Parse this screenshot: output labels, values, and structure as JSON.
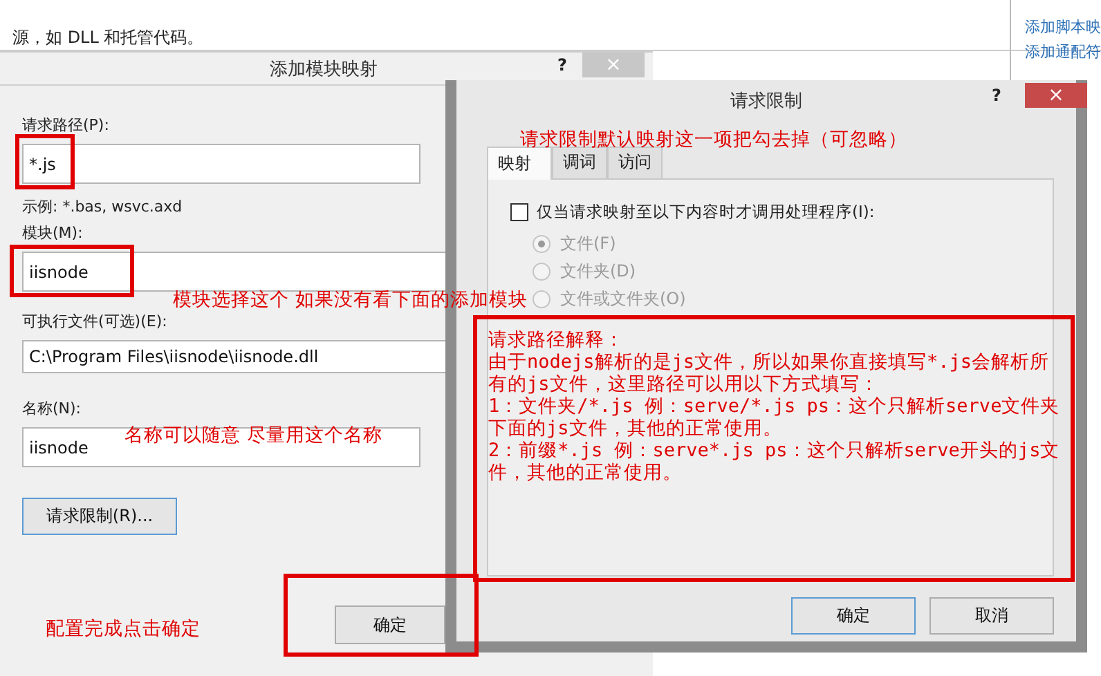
{
  "background": {
    "description": "源，如 DLL 和托管代码。",
    "links": [
      "添加脚本映",
      "添加通配符"
    ]
  },
  "module_dialog": {
    "title": "添加模块映射",
    "help": "?",
    "close": "×",
    "fields": [
      {
        "label": "请求路径(P):",
        "value": "*.js",
        "hint": "示例: *.bas, wsvc.axd"
      },
      {
        "label": "模块(M):",
        "value": "iisnode"
      },
      {
        "label": "可执行文件(可选)(E):",
        "value": "C:\\Program Files\\iisnode\\iisnode.dll"
      },
      {
        "label": "名称(N):",
        "value": "iisnode"
      }
    ],
    "restrict_button": "请求限制(R)...",
    "ok_button": "确定"
  },
  "restriction_dialog": {
    "title": "请求限制",
    "help": "?",
    "close": "×",
    "tabs": [
      {
        "label": "映射",
        "selected": true
      },
      {
        "label": "调词",
        "selected": false
      },
      {
        "label": "访问",
        "selected": false
      }
    ],
    "checkbox": {
      "label": "仅当请求映射至以下内容时才调用处理程序(I):",
      "checked": false
    },
    "radios": [
      {
        "label": "文件(F)",
        "selected": true,
        "disabled": true
      },
      {
        "label": "文件夹(D)",
        "selected": false,
        "disabled": true
      },
      {
        "label": "文件或文件夹(O)",
        "selected": false,
        "disabled": true
      }
    ],
    "buttons": [
      "确定",
      "取消"
    ]
  },
  "annotations": [
    {
      "kind": "note",
      "text": "请求限制默认映射这一项把勾去掉（可忽略）"
    },
    {
      "kind": "note",
      "text": "模块选择这个 如果没有看下面的添加模块"
    },
    {
      "kind": "note",
      "text": "名称可以随意 尽量用这个名称"
    },
    {
      "kind": "note",
      "text": "配置完成点击确定"
    }
  ],
  "explanation": [
    "请求路径解释：",
    "由于nodejs解析的是js文件，所以如果你直接填写*.js会解析所有的js文件，这里路径可以用以下方式填写：",
    "1：文件夹/*.js  例：serve/*.js  ps：这个只解析serve文件夹下面的js文件，其他的正常使用。",
    "2：前缀*.js  例：serve*.js ps：这个只解析serve开头的js文件，其他的正常使用。"
  ]
}
